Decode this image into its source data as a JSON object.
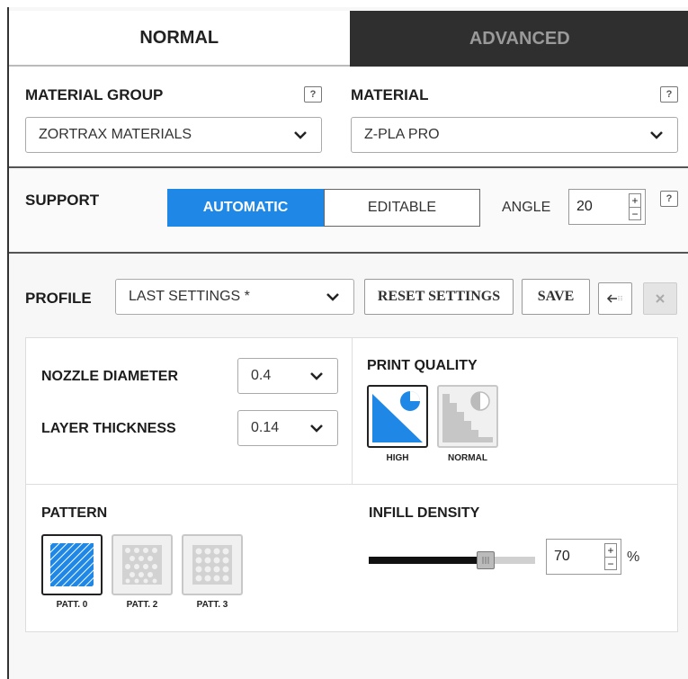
{
  "tabs": [
    {
      "label": "NORMAL",
      "active": true
    },
    {
      "label": "ADVANCED",
      "active": false
    }
  ],
  "material_group": {
    "label": "MATERIAL GROUP",
    "help": "?",
    "selected": "ZORTRAX MATERIALS"
  },
  "material": {
    "label": "MATERIAL",
    "help": "?",
    "selected": "Z-PLA PRO"
  },
  "support": {
    "label": "SUPPORT",
    "mode_automatic": "AUTOMATIC",
    "mode_editable": "EDITABLE",
    "active_mode": "AUTOMATIC",
    "angle_label": "ANGLE",
    "angle_value": "20",
    "help": "?"
  },
  "profile": {
    "label": "PROFILE",
    "selected": "LAST SETTINGS *",
    "reset_label": "RESET SETTINGS",
    "save_label": "SAVE"
  },
  "nozzle": {
    "label": "NOZZLE DIAMETER",
    "value": "0.4"
  },
  "layer": {
    "label": "LAYER THICKNESS",
    "value": "0.14"
  },
  "print_quality": {
    "label": "PRINT QUALITY",
    "options": [
      {
        "label": "HIGH",
        "selected": true
      },
      {
        "label": "NORMAL",
        "selected": false
      }
    ]
  },
  "pattern": {
    "label": "PATTERN",
    "options": [
      {
        "label": "PATT. 0",
        "selected": true
      },
      {
        "label": "PATT. 2",
        "selected": false
      },
      {
        "label": "PATT. 3",
        "selected": false
      }
    ]
  },
  "infill": {
    "label": "INFILL DENSITY",
    "value": "70",
    "unit": "%",
    "fraction": 0.7
  },
  "colors": {
    "accent": "#1f87e6",
    "dark_tab": "#2f2f2f"
  }
}
